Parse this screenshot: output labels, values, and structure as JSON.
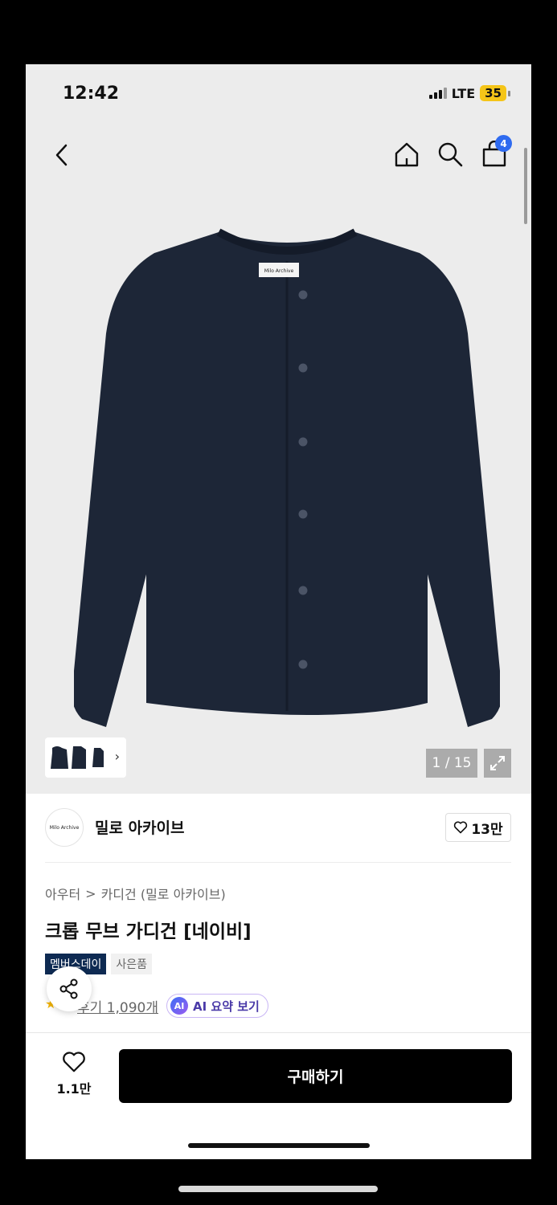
{
  "status": {
    "time": "12:42",
    "network": "LTE",
    "battery": "35"
  },
  "header": {
    "cart_count": "4"
  },
  "gallery": {
    "counter": "1 / 15",
    "label_on_garment": "Milo Archive"
  },
  "brand": {
    "logo_text": "Milo Archive",
    "name": "밀로 아카이브",
    "likes": "13만"
  },
  "breadcrumb": {
    "category": "아우터",
    "separator": ">",
    "subcategory": "카디건 (밀로 아카이브)"
  },
  "product": {
    "title": "크롭 무브 가디건 [네이비]"
  },
  "badges": {
    "members_day": "멤버스데이",
    "gift": "사은품"
  },
  "reviews": {
    "link": "후기 1,090개",
    "ai_badge": "AI",
    "ai_summary": "AI 요약 보기"
  },
  "bottom": {
    "wish_count": "1.1만",
    "buy_label": "구매하기"
  },
  "colors": {
    "garment": "#1d2637",
    "cart_badge": "#2f6bf0",
    "members_badge": "#0e2a52",
    "battery": "#f5c518"
  }
}
